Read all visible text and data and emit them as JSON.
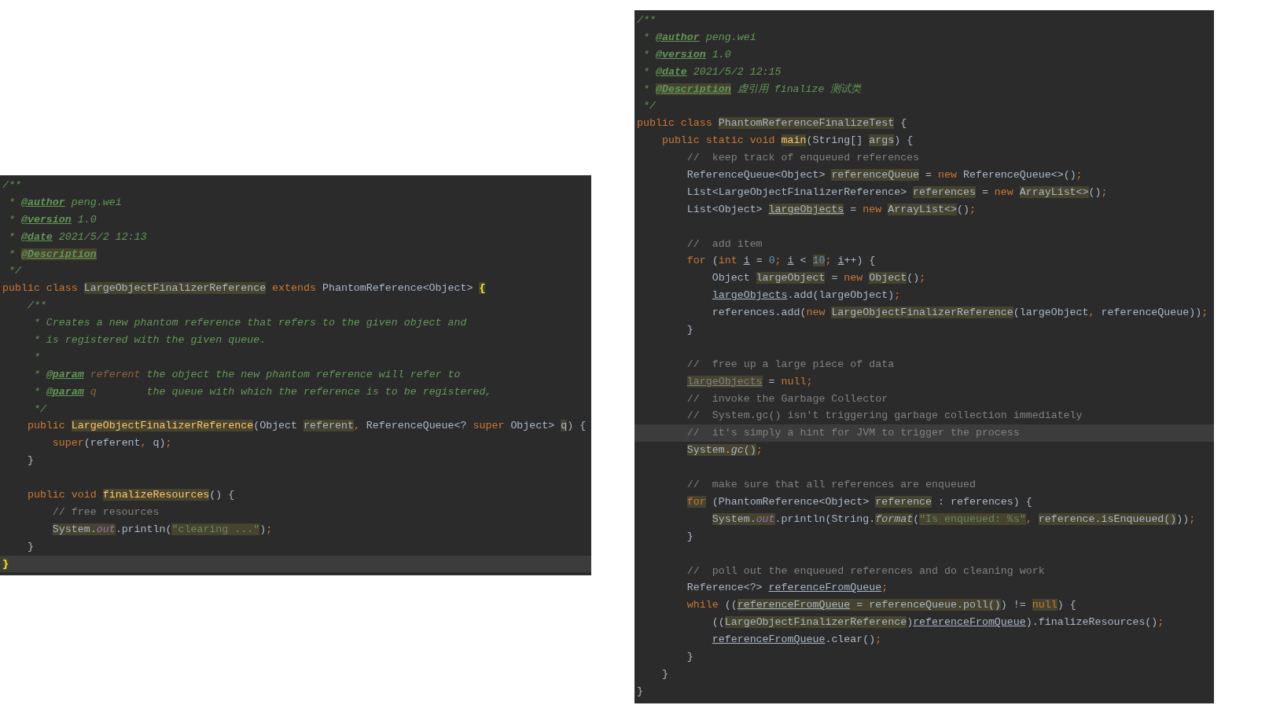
{
  "editors": [
    {
      "lines": [
        {
          "current": false,
          "tokens": [
            {
              "text": "/**",
              "kind": "doc",
              "highlighted": false
            }
          ]
        },
        {
          "current": false,
          "tokens": [
            {
              "text": " * ",
              "kind": "doc",
              "highlighted": false
            },
            {
              "text": "@author",
              "kind": "doctag",
              "highlighted": false
            },
            {
              "text": " peng.wei",
              "kind": "doc",
              "highlighted": false
            }
          ]
        },
        {
          "current": false,
          "tokens": [
            {
              "text": " * ",
              "kind": "doc",
              "highlighted": false
            },
            {
              "text": "@version",
              "kind": "doctag",
              "highlighted": false
            },
            {
              "text": " 1.0",
              "kind": "doc",
              "highlighted": false
            }
          ]
        },
        {
          "current": false,
          "tokens": [
            {
              "text": " * ",
              "kind": "doc",
              "highlighted": false
            },
            {
              "text": "@date",
              "kind": "doctag",
              "highlighted": false
            },
            {
              "text": " 2021/5/2 12:13",
              "kind": "doc",
              "highlighted": false
            }
          ]
        },
        {
          "current": false,
          "tokens": [
            {
              "text": " * ",
              "kind": "doc",
              "highlighted": false
            },
            {
              "text": "@Description",
              "kind": "doctag",
              "highlighted": true
            }
          ]
        },
        {
          "current": false,
          "tokens": [
            {
              "text": " */",
              "kind": "doc",
              "highlighted": false
            }
          ]
        },
        {
          "current": false,
          "tokens": [
            {
              "text": "public class ",
              "kind": "keyword",
              "highlighted": false
            },
            {
              "text": "LargeObjectFinalizerReference",
              "kind": "plain",
              "highlighted": true
            },
            {
              "text": " extends",
              "kind": "keyword",
              "highlighted": false
            },
            {
              "text": " PhantomReference<Object> ",
              "kind": "plain",
              "highlighted": false
            },
            {
              "text": "{",
              "kind": "brace",
              "highlighted": true
            }
          ]
        },
        {
          "current": false,
          "tokens": [
            {
              "text": "    /**",
              "kind": "doc",
              "highlighted": false
            }
          ]
        },
        {
          "current": false,
          "tokens": [
            {
              "text": "     * Creates a new phantom reference that refers to the given object and",
              "kind": "doc",
              "highlighted": false
            }
          ]
        },
        {
          "current": false,
          "tokens": [
            {
              "text": "     * is registered with the given queue.",
              "kind": "doc",
              "highlighted": false
            }
          ]
        },
        {
          "current": false,
          "tokens": [
            {
              "text": "     *",
              "kind": "doc",
              "highlighted": false
            }
          ]
        },
        {
          "current": false,
          "tokens": [
            {
              "text": "     * ",
              "kind": "doc",
              "highlighted": false
            },
            {
              "text": "@param",
              "kind": "doctag",
              "highlighted": false
            },
            {
              "text": " referent",
              "kind": "docparam",
              "highlighted": false
            },
            {
              "text": " the object the new phantom reference will refer to",
              "kind": "doc",
              "highlighted": false
            }
          ]
        },
        {
          "current": false,
          "tokens": [
            {
              "text": "     * ",
              "kind": "doc",
              "highlighted": false
            },
            {
              "text": "@param",
              "kind": "doctag",
              "highlighted": false
            },
            {
              "text": " q",
              "kind": "docparam",
              "highlighted": false
            },
            {
              "text": "        the queue with which the reference is to be registered,",
              "kind": "doc",
              "highlighted": false
            }
          ]
        },
        {
          "current": false,
          "tokens": [
            {
              "text": "     */",
              "kind": "doc",
              "highlighted": false
            }
          ]
        },
        {
          "current": false,
          "tokens": [
            {
              "text": "    public ",
              "kind": "keyword",
              "highlighted": false
            },
            {
              "text": "LargeObjectFinalizerReference",
              "kind": "method",
              "highlighted": true
            },
            {
              "text": "(Object ",
              "kind": "plain",
              "highlighted": false
            },
            {
              "text": "referent",
              "kind": "plain",
              "highlighted": true
            },
            {
              "text": ", ",
              "kind": "keyword",
              "highlighted": false
            },
            {
              "text": "ReferenceQueue<? ",
              "kind": "plain",
              "highlighted": false
            },
            {
              "text": "super",
              "kind": "keyword",
              "highlighted": false
            },
            {
              "text": " Object> ",
              "kind": "plain",
              "highlighted": false
            },
            {
              "text": "q",
              "kind": "plain",
              "highlighted": true
            },
            {
              "text": ") {",
              "kind": "plain",
              "highlighted": false
            }
          ]
        },
        {
          "current": false,
          "tokens": [
            {
              "text": "        super",
              "kind": "keyword",
              "highlighted": false
            },
            {
              "text": "(referent",
              "kind": "plain",
              "highlighted": false
            },
            {
              "text": ", ",
              "kind": "keyword",
              "highlighted": false
            },
            {
              "text": "q)",
              "kind": "plain",
              "highlighted": false
            },
            {
              "text": ";",
              "kind": "keyword",
              "highlighted": false
            }
          ]
        },
        {
          "current": false,
          "tokens": [
            {
              "text": "    }",
              "kind": "plain",
              "highlighted": false
            }
          ]
        },
        {
          "current": false
        },
        {
          "current": false,
          "tokens": [
            {
              "text": "    public void ",
              "kind": "keyword",
              "highlighted": false
            },
            {
              "text": "finalizeResources",
              "kind": "method",
              "highlighted": true
            },
            {
              "text": "() {",
              "kind": "plain",
              "highlighted": false
            }
          ]
        },
        {
          "current": false,
          "tokens": [
            {
              "text": "        // free resources",
              "kind": "comment",
              "highlighted": false
            }
          ]
        },
        {
          "current": false,
          "tokens": [
            {
              "text": "        System.",
              "kind": "plain",
              "highlighted": true
            },
            {
              "text": "out",
              "kind": "field",
              "highlighted": true
            },
            {
              "text": ".println(",
              "kind": "plain",
              "highlighted": false
            },
            {
              "text": "\"clearing ...\"",
              "kind": "string",
              "highlighted": true
            },
            {
              "text": ")",
              "kind": "plain",
              "highlighted": false
            },
            {
              "text": ";",
              "kind": "keyword",
              "highlighted": false
            }
          ]
        },
        {
          "current": false,
          "tokens": [
            {
              "text": "    }",
              "kind": "plain",
              "highlighted": false
            }
          ]
        },
        {
          "current": true,
          "tokens": [
            {
              "text": "}",
              "kind": "brace",
              "highlighted": true
            }
          ]
        }
      ]
    },
    {
      "lines": [
        {
          "current": false,
          "tokens": [
            {
              "text": "/**",
              "kind": "doc",
              "highlighted": false
            }
          ]
        },
        {
          "current": false,
          "tokens": [
            {
              "text": " * ",
              "kind": "doc",
              "highlighted": false
            },
            {
              "text": "@author",
              "kind": "doctag",
              "highlighted": false
            },
            {
              "text": " peng.wei",
              "kind": "doc",
              "highlighted": false
            }
          ]
        },
        {
          "current": false,
          "tokens": [
            {
              "text": " * ",
              "kind": "doc",
              "highlighted": false
            },
            {
              "text": "@version",
              "kind": "doctag",
              "highlighted": false
            },
            {
              "text": " 1.0",
              "kind": "doc",
              "highlighted": false
            }
          ]
        },
        {
          "current": false,
          "tokens": [
            {
              "text": " * ",
              "kind": "doc",
              "highlighted": false
            },
            {
              "text": "@date",
              "kind": "doctag",
              "highlighted": false
            },
            {
              "text": " 2021/5/2 12:15",
              "kind": "doc",
              "highlighted": false
            }
          ]
        },
        {
          "current": false,
          "tokens": [
            {
              "text": " * ",
              "kind": "doc",
              "highlighted": false
            },
            {
              "text": "@Description",
              "kind": "doctag",
              "highlighted": true
            },
            {
              "text": " 虚引用 finalize 测试类",
              "kind": "doc",
              "highlighted": false
            }
          ]
        },
        {
          "current": false,
          "tokens": [
            {
              "text": " */",
              "kind": "doc",
              "highlighted": false
            }
          ]
        },
        {
          "current": false,
          "tokens": [
            {
              "text": "public class ",
              "kind": "keyword",
              "highlighted": false
            },
            {
              "text": "PhantomReferenceFinalizeTest",
              "kind": "plain",
              "highlighted": true
            },
            {
              "text": " {",
              "kind": "plain",
              "highlighted": false
            }
          ]
        },
        {
          "current": false,
          "tokens": [
            {
              "text": "    public static void ",
              "kind": "keyword",
              "highlighted": false
            },
            {
              "text": "main",
              "kind": "method",
              "highlighted": true
            },
            {
              "text": "(String[] ",
              "kind": "plain",
              "highlighted": false
            },
            {
              "text": "args",
              "kind": "plain",
              "highlighted": true
            },
            {
              "text": ") {",
              "kind": "plain",
              "highlighted": false
            }
          ]
        },
        {
          "current": false,
          "tokens": [
            {
              "text": "        //  keep track of enqueued references",
              "kind": "comment",
              "highlighted": false
            }
          ]
        },
        {
          "current": false,
          "tokens": [
            {
              "text": "        ReferenceQueue<Object> ",
              "kind": "plain",
              "highlighted": false
            },
            {
              "text": "referenceQueue",
              "kind": "plain",
              "highlighted": true
            },
            {
              "text": " = ",
              "kind": "plain",
              "highlighted": false
            },
            {
              "text": "new",
              "kind": "keyword",
              "highlighted": false
            },
            {
              "text": " ReferenceQueue<>()",
              "kind": "plain",
              "highlighted": false
            },
            {
              "text": ";",
              "kind": "keyword",
              "highlighted": false
            }
          ]
        },
        {
          "current": false,
          "tokens": [
            {
              "text": "        List<LargeObjectFinalizerReference> ",
              "kind": "plain",
              "highlighted": false
            },
            {
              "text": "references",
              "kind": "plain",
              "highlighted": true
            },
            {
              "text": " = ",
              "kind": "plain",
              "highlighted": false
            },
            {
              "text": "new ",
              "kind": "keyword",
              "highlighted": false
            },
            {
              "text": "ArrayList<>",
              "kind": "plain",
              "highlighted": true
            },
            {
              "text": "()",
              "kind": "plain",
              "highlighted": false
            },
            {
              "text": ";",
              "kind": "keyword",
              "highlighted": false
            }
          ]
        },
        {
          "current": false,
          "tokens": [
            {
              "text": "        List<Object> ",
              "kind": "plain",
              "highlighted": false
            },
            {
              "text": "largeObjects",
              "kind": "reassigned",
              "highlighted": true
            },
            {
              "text": " = ",
              "kind": "plain",
              "highlighted": false
            },
            {
              "text": "new ",
              "kind": "keyword",
              "highlighted": false
            },
            {
              "text": "ArrayList<>",
              "kind": "plain",
              "highlighted": true
            },
            {
              "text": "()",
              "kind": "plain",
              "highlighted": false
            },
            {
              "text": ";",
              "kind": "keyword",
              "highlighted": false
            }
          ]
        },
        {
          "current": false
        },
        {
          "current": false,
          "tokens": [
            {
              "text": "        //  add item",
              "kind": "comment",
              "highlighted": false
            }
          ]
        },
        {
          "current": false,
          "tokens": [
            {
              "text": "        for",
              "kind": "keyword",
              "highlighted": false
            },
            {
              "text": " (",
              "kind": "plain",
              "highlighted": false
            },
            {
              "text": "int ",
              "kind": "keyword",
              "highlighted": false
            },
            {
              "text": "i",
              "kind": "reassigned",
              "highlighted": false
            },
            {
              "text": " = ",
              "kind": "plain",
              "highlighted": false
            },
            {
              "text": "0",
              "kind": "number",
              "highlighted": false
            },
            {
              "text": "; ",
              "kind": "keyword",
              "highlighted": false
            },
            {
              "text": "i",
              "kind": "reassigned",
              "highlighted": false
            },
            {
              "text": " < ",
              "kind": "plain",
              "highlighted": false
            },
            {
              "text": "10",
              "kind": "number",
              "highlighted": true
            },
            {
              "text": "; ",
              "kind": "keyword",
              "highlighted": false
            },
            {
              "text": "i",
              "kind": "reassigned",
              "highlighted": false
            },
            {
              "text": "++) {",
              "kind": "plain",
              "highlighted": false
            }
          ]
        },
        {
          "current": false,
          "tokens": [
            {
              "text": "            Object ",
              "kind": "plain",
              "highlighted": false
            },
            {
              "text": "largeObject",
              "kind": "plain",
              "highlighted": true
            },
            {
              "text": " = ",
              "kind": "plain",
              "highlighted": false
            },
            {
              "text": "new ",
              "kind": "keyword",
              "highlighted": false
            },
            {
              "text": "Object",
              "kind": "plain",
              "highlighted": true
            },
            {
              "text": "()",
              "kind": "plain",
              "highlighted": false
            },
            {
              "text": ";",
              "kind": "keyword",
              "highlighted": false
            }
          ]
        },
        {
          "current": false,
          "tokens": [
            {
              "text": "            largeObjects",
              "kind": "reassigned",
              "highlighted": false
            },
            {
              "text": ".add(largeObject)",
              "kind": "plain",
              "highlighted": false
            },
            {
              "text": ";",
              "kind": "keyword",
              "highlighted": false
            }
          ]
        },
        {
          "current": false,
          "tokens": [
            {
              "text": "            references.add(",
              "kind": "plain",
              "highlighted": false
            },
            {
              "text": "new ",
              "kind": "keyword",
              "highlighted": false
            },
            {
              "text": "LargeObjectFinalizerReference",
              "kind": "plain",
              "highlighted": true
            },
            {
              "text": "(largeObject",
              "kind": "plain",
              "highlighted": false
            },
            {
              "text": ", ",
              "kind": "keyword",
              "highlighted": false
            },
            {
              "text": "referenceQueue))",
              "kind": "plain",
              "highlighted": false
            },
            {
              "text": ";",
              "kind": "keyword",
              "highlighted": false
            }
          ]
        },
        {
          "current": false,
          "tokens": [
            {
              "text": "        }",
              "kind": "plain",
              "highlighted": false
            }
          ]
        },
        {
          "current": false
        },
        {
          "current": false,
          "tokens": [
            {
              "text": "        //  free up a large piece of data",
              "kind": "comment",
              "highlighted": false
            }
          ]
        },
        {
          "current": false,
          "tokens": [
            {
              "text": "        largeObjects",
              "kind": "unused",
              "highlighted": true
            },
            {
              "text": " = ",
              "kind": "plain",
              "highlighted": false
            },
            {
              "text": "null;",
              "kind": "keyword",
              "highlighted": false
            }
          ]
        },
        {
          "current": false,
          "tokens": [
            {
              "text": "        //  invoke the Garbage Collector",
              "kind": "comment",
              "highlighted": false
            }
          ]
        },
        {
          "current": false,
          "tokens": [
            {
              "text": "        //  System.gc() isn't triggering garbage collection immediately",
              "kind": "comment",
              "highlighted": false
            }
          ]
        },
        {
          "current": true,
          "tokens": [
            {
              "text": "        //  it's simply a hint for JVM to trigger the process",
              "kind": "comment",
              "highlighted": false
            }
          ]
        },
        {
          "current": false,
          "tokens": [
            {
              "text": "        System.",
              "kind": "plain",
              "highlighted": true
            },
            {
              "text": "gc",
              "kind": "static",
              "highlighted": true
            },
            {
              "text": "()",
              "kind": "plain",
              "highlighted": true
            },
            {
              "text": ";",
              "kind": "keyword",
              "highlighted": false
            }
          ]
        },
        {
          "current": false
        },
        {
          "current": false,
          "tokens": [
            {
              "text": "        //  make sure that all references are enqueued",
              "kind": "comment",
              "highlighted": false
            }
          ]
        },
        {
          "current": false,
          "tokens": [
            {
              "text": "        for",
              "kind": "keyword",
              "highlighted": true
            },
            {
              "text": " (PhantomReference<Object> ",
              "kind": "plain",
              "highlighted": false
            },
            {
              "text": "reference",
              "kind": "plain",
              "highlighted": true
            },
            {
              "text": " : references) {",
              "kind": "plain",
              "highlighted": false
            }
          ]
        },
        {
          "current": false,
          "tokens": [
            {
              "text": "            System.",
              "kind": "plain",
              "highlighted": true
            },
            {
              "text": "out",
              "kind": "field",
              "highlighted": true
            },
            {
              "text": ".println(String.",
              "kind": "plain",
              "highlighted": false
            },
            {
              "text": "format",
              "kind": "static",
              "highlighted": true
            },
            {
              "text": "(",
              "kind": "plain",
              "highlighted": false
            },
            {
              "text": "\"Is enqueued: %s\"",
              "kind": "string",
              "highlighted": true
            },
            {
              "text": ", ",
              "kind": "keyword",
              "highlighted": false
            },
            {
              "text": "reference.isEnqueued()",
              "kind": "plain",
              "highlighted": true
            },
            {
              "text": "))",
              "kind": "plain",
              "highlighted": false
            },
            {
              "text": ";",
              "kind": "keyword",
              "highlighted": false
            }
          ]
        },
        {
          "current": false,
          "tokens": [
            {
              "text": "        }",
              "kind": "plain",
              "highlighted": false
            }
          ]
        },
        {
          "current": false
        },
        {
          "current": false,
          "tokens": [
            {
              "text": "        //  poll out the enqueued references and do cleaning work",
              "kind": "comment",
              "highlighted": false
            }
          ]
        },
        {
          "current": false,
          "tokens": [
            {
              "text": "        Reference<?> ",
              "kind": "plain",
              "highlighted": false
            },
            {
              "text": "referenceFromQueue",
              "kind": "reassigned",
              "highlighted": false
            },
            {
              "text": ";",
              "kind": "keyword",
              "highlighted": false
            }
          ]
        },
        {
          "current": false,
          "tokens": [
            {
              "text": "        while",
              "kind": "keyword",
              "highlighted": false
            },
            {
              "text": " ((",
              "kind": "plain",
              "highlighted": false
            },
            {
              "text": "referenceFromQueue",
              "kind": "reassigned",
              "highlighted": true
            },
            {
              "text": " = referenceQueue.poll()",
              "kind": "plain",
              "highlighted": true
            },
            {
              "text": ") != ",
              "kind": "plain",
              "highlighted": false
            },
            {
              "text": "null",
              "kind": "keyword",
              "highlighted": true
            },
            {
              "text": ") {",
              "kind": "plain",
              "highlighted": false
            }
          ]
        },
        {
          "current": false,
          "tokens": [
            {
              "text": "            ((",
              "kind": "plain",
              "highlighted": false
            },
            {
              "text": "LargeObjectFinalizerReference",
              "kind": "plain",
              "highlighted": true
            },
            {
              "text": ")",
              "kind": "plain",
              "highlighted": false
            },
            {
              "text": "referenceFromQueue",
              "kind": "reassigned",
              "highlighted": false
            },
            {
              "text": ").finalizeResources()",
              "kind": "plain",
              "highlighted": false
            },
            {
              "text": ";",
              "kind": "keyword",
              "highlighted": false
            }
          ]
        },
        {
          "current": false,
          "tokens": [
            {
              "text": "            referenceFromQueue",
              "kind": "reassigned",
              "highlighted": false
            },
            {
              "text": ".clear()",
              "kind": "plain",
              "highlighted": false
            },
            {
              "text": ";",
              "kind": "keyword",
              "highlighted": false
            }
          ]
        },
        {
          "current": false,
          "tokens": [
            {
              "text": "        }",
              "kind": "plain",
              "highlighted": false
            }
          ]
        },
        {
          "current": false,
          "tokens": [
            {
              "text": "    }",
              "kind": "plain",
              "highlighted": false
            }
          ]
        },
        {
          "current": false,
          "tokens": [
            {
              "text": "}",
              "kind": "plain",
              "highlighted": false
            }
          ]
        }
      ]
    }
  ]
}
